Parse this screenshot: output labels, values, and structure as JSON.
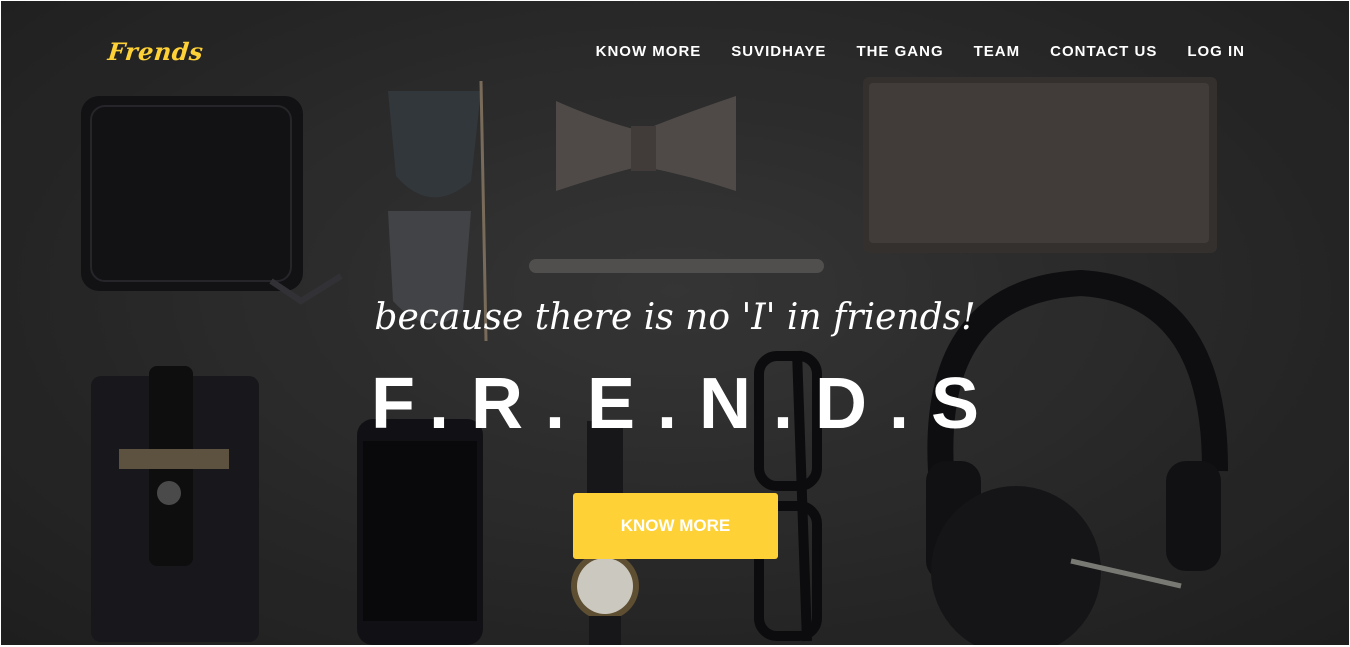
{
  "brand": {
    "name": "Frends",
    "color": "#fed136"
  },
  "nav": {
    "items": [
      {
        "label": "KNOW MORE"
      },
      {
        "label": "SUVIDHAYE"
      },
      {
        "label": "THE GANG"
      },
      {
        "label": "TEAM"
      },
      {
        "label": "CONTACT US"
      },
      {
        "label": "LOG IN"
      }
    ]
  },
  "hero": {
    "tagline": "because there is no 'I' in friends!",
    "title": "F.R.E.N.D.S",
    "cta_label": "KNOW MORE",
    "background_image": "flat lay of wallet, sunglasses, bow tie, pen, notebook, phone case, phone, watch, glasses, headphones on dark surface"
  }
}
